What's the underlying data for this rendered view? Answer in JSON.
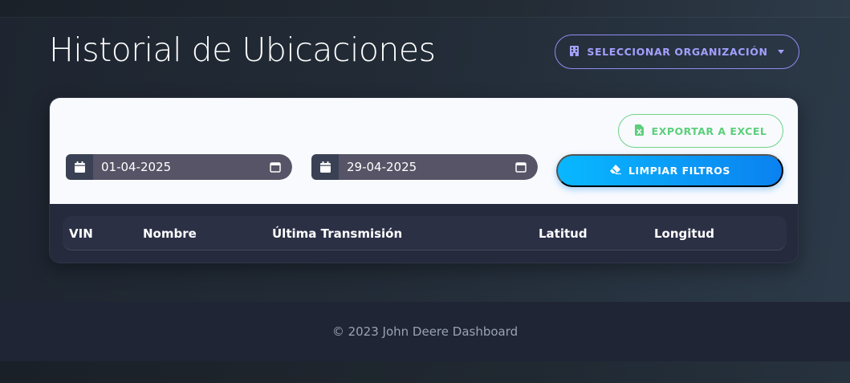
{
  "page": {
    "title": "Historial de Ubicaciones"
  },
  "header": {
    "org_button_label": "SELECCIONAR ORGANIZACIÓN",
    "org_button_icon": "building-icon"
  },
  "filters": {
    "faint_label": "",
    "start_date": "01-04-2025",
    "end_date": "29-04-2025",
    "export_label": "EXPORTAR A EXCEL",
    "clear_label": "LIMPIAR FILTROS"
  },
  "table": {
    "columns": [
      "VIN",
      "Nombre",
      "Última Transmisión",
      "Latitud",
      "Longitud"
    ],
    "rows": []
  },
  "footer": {
    "text": "© 2023 John Deere Dashboard"
  },
  "colors": {
    "accent_purple": "#a3a0ff",
    "export_green": "#5ccf7b",
    "primary_blue": "#0a9cf8",
    "card_top_bg": "#f8fafe"
  }
}
